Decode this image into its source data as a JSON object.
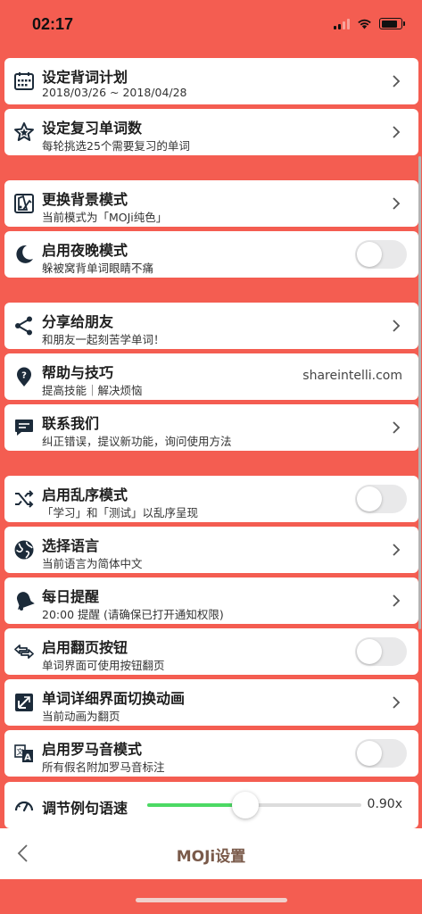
{
  "status": {
    "time": "02:17"
  },
  "groups": [
    {
      "items": [
        {
          "title": "设定背词计划",
          "subtitle": "2018/03/26 ~ 2018/04/28",
          "icon": "calendar-icon",
          "control": "chevron"
        },
        {
          "title": "设定复习单词数",
          "subtitle": "每轮挑选25个需要复习的单词",
          "icon": "star-icon",
          "control": "chevron"
        }
      ]
    },
    {
      "items": [
        {
          "title": "更换背景模式",
          "subtitle": "当前模式为「MOJi纯色」",
          "icon": "palette-icon",
          "control": "chevron"
        },
        {
          "title": "启用夜晚模式",
          "subtitle": "躲被窝背单词眼睛不痛",
          "icon": "moon-icon",
          "control": "toggle",
          "on": false
        }
      ]
    },
    {
      "items": [
        {
          "title": "分享给朋友",
          "subtitle": "和朋友一起刻苦学单词！",
          "icon": "share-icon",
          "control": "chevron"
        },
        {
          "title": "帮助与技巧",
          "subtitle": "提高技能｜解决烦恼",
          "icon": "help-pin-icon",
          "control": "text",
          "value": "shareintelli.com"
        },
        {
          "title": "联系我们",
          "subtitle": "纠正错误，提议新功能，询问使用方法",
          "icon": "message-icon",
          "control": "chevron"
        }
      ]
    },
    {
      "items": [
        {
          "title": "启用乱序模式",
          "subtitle": "「学习」和「测试」以乱序呈现",
          "icon": "shuffle-icon",
          "control": "toggle",
          "on": false
        },
        {
          "title": "选择语言",
          "subtitle": "当前语言为简体中文",
          "icon": "globe-icon",
          "control": "chevron"
        },
        {
          "title": "每日提醒",
          "subtitle": "20:00 提醒 (请确保已打开通知权限)",
          "icon": "bell-icon",
          "control": "chevron"
        },
        {
          "title": "启用翻页按钮",
          "subtitle": "单词界面可使用按钮翻页",
          "icon": "swap-arrows-icon",
          "control": "toggle",
          "on": false
        },
        {
          "title": "单词详细界面切换动画",
          "subtitle": "当前动画为翻页",
          "icon": "page-flip-icon",
          "control": "chevron"
        },
        {
          "title": "启用罗马音模式",
          "subtitle": "所有假名附加罗马音标注",
          "icon": "translate-icon",
          "control": "toggle",
          "on": false
        },
        {
          "title": "调节例句语速",
          "subtitle": "",
          "icon": "speedometer-icon",
          "control": "slider",
          "slider_fraction": 0.46,
          "value": "0.90x"
        }
      ]
    }
  ],
  "nav": {
    "title": "MOJi设置",
    "back_icon": "chevron-left-icon"
  },
  "colors": {
    "background": "#f45d51",
    "card": "#ffffff",
    "slider_fill": "#4cd964",
    "title_text": "#7a5a4a"
  }
}
